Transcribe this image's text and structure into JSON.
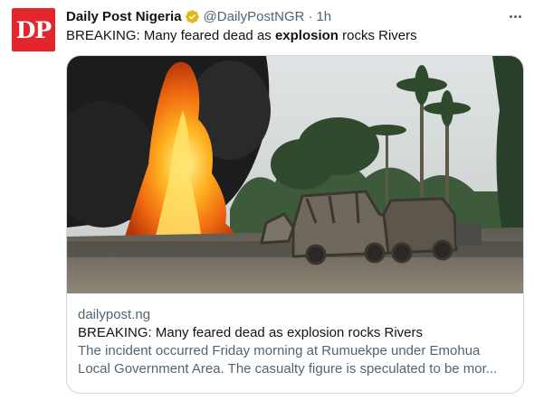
{
  "author": {
    "avatar_text": "DP",
    "name": "Daily Post Nigeria",
    "handle": "@DailyPostNGR",
    "separator": "·",
    "time": "1h",
    "verified_icon": "verified-badge-gold"
  },
  "tweet": {
    "text_before": "BREAKING: Many feared dead as ",
    "text_bold": "explosion",
    "text_after": " rocks Rivers"
  },
  "card": {
    "domain": "dailypost.ng",
    "title": "BREAKING: Many feared dead as explosion rocks Rivers",
    "description_line1": "The incident occurred Friday morning at Rumuekpe under Emohua",
    "description_line2": "Local Government Area. The casualty figure is speculated to be mor..."
  },
  "colors": {
    "brand_red": "#e3262b",
    "verified_gold": "#e2b719",
    "secondary_text": "#536471",
    "border": "#cfd9de"
  }
}
